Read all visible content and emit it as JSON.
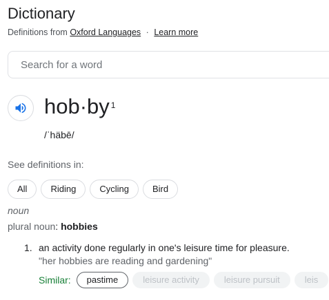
{
  "header": {
    "title": "Dictionary",
    "source_prefix": "Definitions from",
    "source_link": "Oxford Languages",
    "separator": "·",
    "learn_more": "Learn more"
  },
  "search": {
    "placeholder": "Search for a word",
    "value": ""
  },
  "entry": {
    "speaker_icon": "volume-icon",
    "word": "hob·by",
    "superscript": "1",
    "phonetic": "/ˈhäbē/",
    "see_definitions_label": "See definitions in:",
    "chips": [
      {
        "label": "All"
      },
      {
        "label": "Riding"
      },
      {
        "label": "Cycling"
      },
      {
        "label": "Bird"
      }
    ],
    "part_of_speech": "noun",
    "plural_label": "plural noun",
    "plural_colon": ":",
    "plural_value": "hobbies",
    "definitions": [
      {
        "number": "1.",
        "text": "an activity done regularly in one's leisure time for pleasure.",
        "example": "\"her hobbies are reading and gardening\"",
        "similar_label": "Similar:",
        "synonyms": [
          "pastime",
          "leisure activity",
          "leisure pursuit",
          "leis"
        ]
      }
    ]
  },
  "colors": {
    "accent_blue": "#1a73e8",
    "similar_green": "#188038",
    "faded_chip_bg": "#f1f3f4"
  }
}
